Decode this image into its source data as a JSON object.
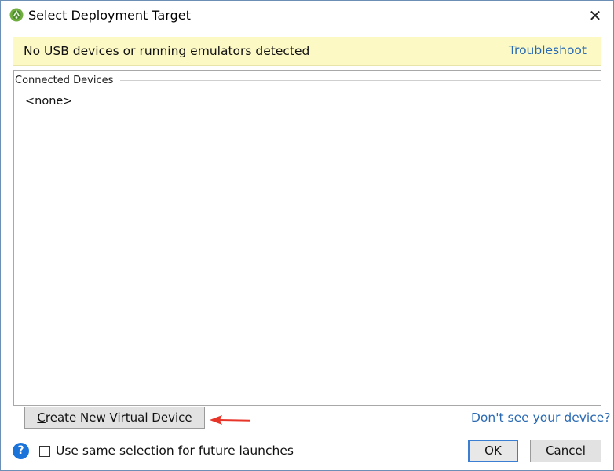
{
  "window": {
    "title": "Select Deployment Target",
    "app_icon": "android-studio-icon",
    "close_label": "✕"
  },
  "banner": {
    "message": "No USB devices or running emulators detected",
    "link": "Troubleshoot"
  },
  "devices": {
    "group_title": "Connected Devices",
    "items": [
      "<none>"
    ]
  },
  "actions": {
    "create_prefix": "C",
    "create_rest": "reate New Virtual Device",
    "dont_see": "Don't see your device?"
  },
  "footer": {
    "help_glyph": "?",
    "checkbox_label": "Use same selection for future launches",
    "checkbox_checked": false,
    "ok_label": "OK",
    "cancel_label": "Cancel"
  },
  "colors": {
    "banner_bg": "#fcf9c5",
    "link": "#2a6ab3",
    "arrow": "#e8352a",
    "help_bg": "#1a73d9"
  }
}
